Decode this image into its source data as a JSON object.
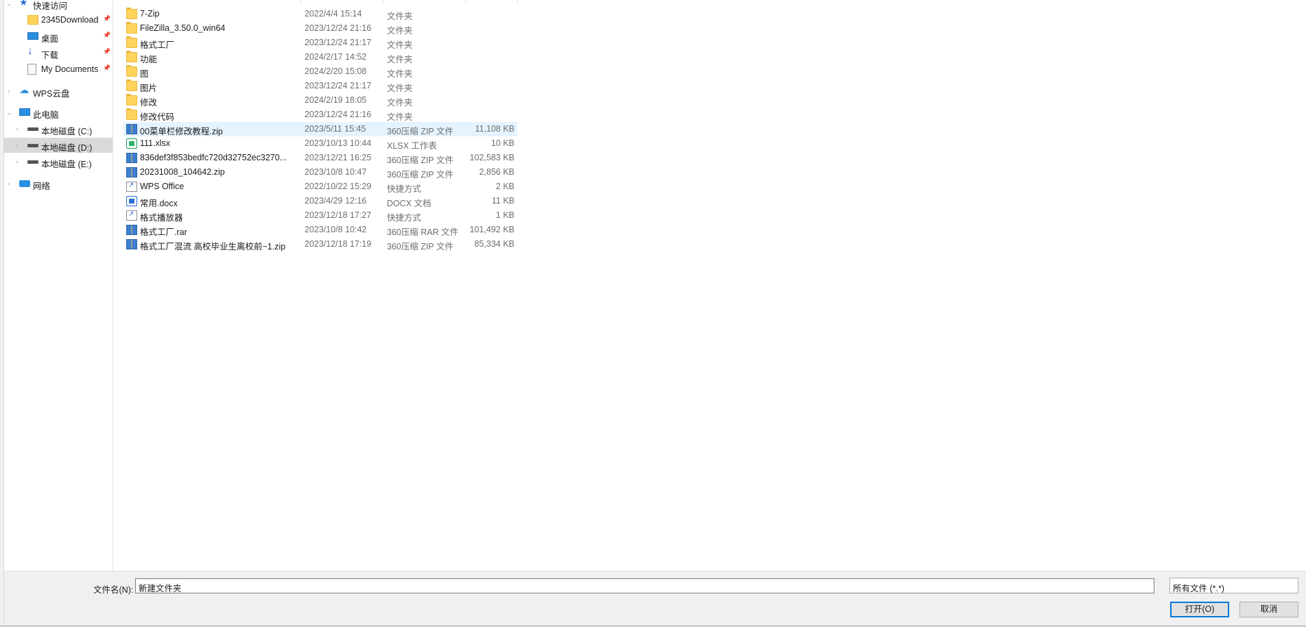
{
  "nav": {
    "items": [
      {
        "label": "快速访问",
        "icon": "star-icon",
        "chevron": "expanded",
        "pinned": false
      },
      {
        "label": "2345Download",
        "icon": "folder-icon",
        "pinned": true
      },
      {
        "label": "桌面",
        "icon": "desktop-icon",
        "pinned": true
      },
      {
        "label": "下载",
        "icon": "download-arrow-icon",
        "pinned": true
      },
      {
        "label": "My Documents",
        "icon": "documents-icon",
        "pinned": true
      },
      {
        "label": "WPS云盘",
        "icon": "cloud-icon",
        "chevron": "collapsed"
      },
      {
        "label": "此电脑",
        "icon": "computer-icon",
        "chevron": "expanded"
      },
      {
        "label": "本地磁盘 (C:)",
        "icon": "drive-icon",
        "chevron": "collapsed"
      },
      {
        "label": "本地磁盘 (D:)",
        "icon": "drive-icon",
        "chevron": "collapsed",
        "selected": true
      },
      {
        "label": "本地磁盘 (E:)",
        "icon": "drive-icon",
        "chevron": "collapsed"
      },
      {
        "label": "网络",
        "icon": "network-icon",
        "chevron": "collapsed"
      }
    ]
  },
  "files": [
    {
      "name": "7-Zip",
      "date": "2022/4/4 15:14",
      "type": "文件夹",
      "size": "",
      "icon": "folder-icon"
    },
    {
      "name": "FileZilla_3.50.0_win64",
      "date": "2023/12/24 21:16",
      "type": "文件夹",
      "size": "",
      "icon": "folder-icon"
    },
    {
      "name": "格式工厂",
      "date": "2023/12/24 21:17",
      "type": "文件夹",
      "size": "",
      "icon": "folder-icon"
    },
    {
      "name": "功能",
      "date": "2024/2/17 14:52",
      "type": "文件夹",
      "size": "",
      "icon": "folder-icon"
    },
    {
      "name": "图",
      "date": "2024/2/20 15:08",
      "type": "文件夹",
      "size": "",
      "icon": "folder-icon"
    },
    {
      "name": "图片",
      "date": "2023/12/24 21:17",
      "type": "文件夹",
      "size": "",
      "icon": "folder-icon"
    },
    {
      "name": "修改",
      "date": "2024/2/19 18:05",
      "type": "文件夹",
      "size": "",
      "icon": "folder-icon"
    },
    {
      "name": "修改代码",
      "date": "2023/12/24 21:16",
      "type": "文件夹",
      "size": "",
      "icon": "folder-icon"
    },
    {
      "name": "00菜单栏修改教程.zip",
      "date": "2023/5/11 15:45",
      "type": "360压缩 ZIP 文件",
      "size": "11,108 KB",
      "icon": "zip-icon",
      "hover": true
    },
    {
      "name": "111.xlsx",
      "date": "2023/10/13 10:44",
      "type": "XLSX 工作表",
      "size": "10 KB",
      "icon": "xlsx-icon"
    },
    {
      "name": "836def3f853bedfc720d32752ec3270...",
      "date": "2023/12/21 16:25",
      "type": "360压缩 ZIP 文件",
      "size": "102,583 KB",
      "icon": "zip-icon"
    },
    {
      "name": "20231008_104642.zip",
      "date": "2023/10/8 10:47",
      "type": "360压缩 ZIP 文件",
      "size": "2,856 KB",
      "icon": "zip-icon"
    },
    {
      "name": "WPS Office",
      "date": "2022/10/22 15:29",
      "type": "快捷方式",
      "size": "2 KB",
      "icon": "shortcut-icon"
    },
    {
      "name": "常用.docx",
      "date": "2023/4/29 12:16",
      "type": "DOCX 文档",
      "size": "11 KB",
      "icon": "docx-icon"
    },
    {
      "name": "格式播放器",
      "date": "2023/12/18 17:27",
      "type": "快捷方式",
      "size": "1 KB",
      "icon": "shortcut-icon"
    },
    {
      "name": "格式工厂.rar",
      "date": "2023/10/8 10:42",
      "type": "360压缩 RAR 文件",
      "size": "101,492 KB",
      "icon": "rar-icon"
    },
    {
      "name": "格式工厂混流 高校毕业生离校前~1.zip",
      "date": "2023/12/18 17:19",
      "type": "360压缩 ZIP 文件",
      "size": "85,334 KB",
      "icon": "zip-icon"
    }
  ],
  "footer": {
    "filename_label": "文件名(N):",
    "filename_value": "新建文件夹",
    "filetype_value": "所有文件 (*.*)",
    "open_label": "打开(O)",
    "cancel_label": "取消"
  }
}
